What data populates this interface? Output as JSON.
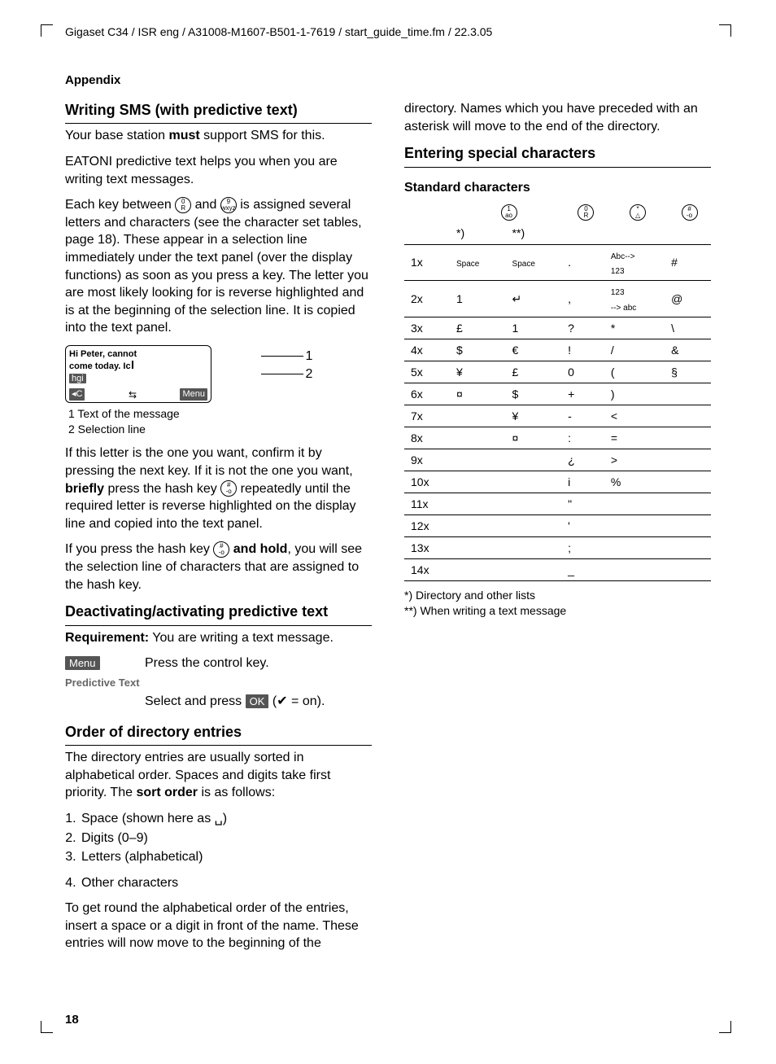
{
  "header": {
    "running": "Gigaset C34 / ISR eng / A31008-M1607-B501-1-7619 / start_guide_time.fm / 22.3.05",
    "section": "Appendix"
  },
  "pagenum": "18",
  "col1": {
    "h_writing": "Writing SMS (with predictive text)",
    "p_must1a": "Your base station ",
    "p_must1b": "must",
    "p_must1c": " support SMS for this.",
    "p_eatoni": "EATONI predictive text helps you when you are writing text messages.",
    "p_each1": "Each key between ",
    "p_each2": " and ",
    "p_each3": " is assigned several letters and characters (see the character set tables, page 18). These appear in a selection line immediately under the text panel (over the display functions) as soon as you press a key. The letter you are most likely looking for is reverse highlighted and is at the beginning of the selection line. It is copied into the text panel.",
    "screen": {
      "line1": "Hi Peter, cannot",
      "line2": "come today. Ic",
      "sel": "hgi",
      "left_key": "◂C",
      "mid_key": "⇆",
      "right_key": "Menu"
    },
    "callout1": "1",
    "callout2": "2",
    "legend1": "1 Text of the message",
    "legend2": "2 Selection line",
    "p_confirm1": "If this letter is the one you want, confirm it by pressing the next key. If it is not the one you want, ",
    "p_confirm2": "briefly",
    "p_confirm3": " press the hash key ",
    "p_confirm4": " repeatedly until the required letter is reverse highlighted on the display line and copied into the text panel.",
    "p_hold1": "If you press the hash key ",
    "p_hold2": " and hold",
    "p_hold3": ", you will see the selection line of characters that are assigned to the hash key.",
    "h_deact": "Deactivating/activating predictive text",
    "p_req1": "Requirement:",
    "p_req2": " You are writing a text message.",
    "step_menu_lab": "Menu",
    "step_menu_txt": "Press the control key.",
    "menupath": "Predictive Text",
    "step_ok1": "Select and press ",
    "step_ok_btn": "OK",
    "step_ok2": " (✔ = on).",
    "h_order": "Order of directory entries",
    "p_order1": "The directory entries are usually sorted in alphabetical order. Spaces and digits take first priority. The ",
    "p_order2": "sort order",
    "p_order3": " is as follows:",
    "ol1": "Space (shown here as ␣)",
    "ol2": "Digits (0–9)",
    "ol3": "Letters (alphabetical)"
  },
  "col2": {
    "ol4": "Other characters",
    "p_round": "To get round the alphabetical order of the entries, insert a space or a digit in front of the name. These entries will now move to the beginning of the directory. Names which you have preceded with an asterisk will move to the end of the directory.",
    "h_special": "Entering special characters",
    "h_standard": "Standard characters",
    "sub1": "*)",
    "sub2": "**)",
    "hdr_keys": [
      "1",
      "0",
      "*",
      "#"
    ],
    "foot1": "*)   Directory and other lists",
    "foot2": "**) When writing a text message"
  },
  "chart_data": {
    "type": "table",
    "title": "Standard characters",
    "column_headers": [
      "press count",
      "key 1 (*)",
      "key 1 (**)",
      "key 0",
      "key *",
      "key #"
    ],
    "rows": [
      {
        "n": "1x",
        "c": [
          "Space",
          "Space",
          ".",
          "Abc--> 123",
          "#"
        ]
      },
      {
        "n": "2x",
        "c": [
          "1",
          "↵",
          ",",
          "123 --> abc",
          "@"
        ]
      },
      {
        "n": "3x",
        "c": [
          "£",
          "1",
          "?",
          "*",
          "\\"
        ]
      },
      {
        "n": "4x",
        "c": [
          "$",
          "€",
          "!",
          "/",
          "&"
        ]
      },
      {
        "n": "5x",
        "c": [
          "¥",
          "£",
          "0",
          "(",
          "§"
        ]
      },
      {
        "n": "6x",
        "c": [
          "¤",
          "$",
          "+",
          ")",
          ""
        ]
      },
      {
        "n": "7x",
        "c": [
          "",
          "¥",
          "-",
          "<",
          ""
        ]
      },
      {
        "n": "8x",
        "c": [
          "",
          "¤",
          ":",
          "=",
          ""
        ]
      },
      {
        "n": "9x",
        "c": [
          "",
          "",
          "¿",
          ">",
          ""
        ]
      },
      {
        "n": "10x",
        "c": [
          "",
          "",
          "i",
          "%",
          ""
        ]
      },
      {
        "n": "11x",
        "c": [
          "",
          "",
          "\"",
          "",
          ""
        ]
      },
      {
        "n": "12x",
        "c": [
          "",
          "",
          "'",
          "",
          ""
        ]
      },
      {
        "n": "13x",
        "c": [
          "",
          "",
          ";",
          "",
          ""
        ]
      },
      {
        "n": "14x",
        "c": [
          "",
          "",
          "_",
          "",
          ""
        ]
      }
    ]
  }
}
